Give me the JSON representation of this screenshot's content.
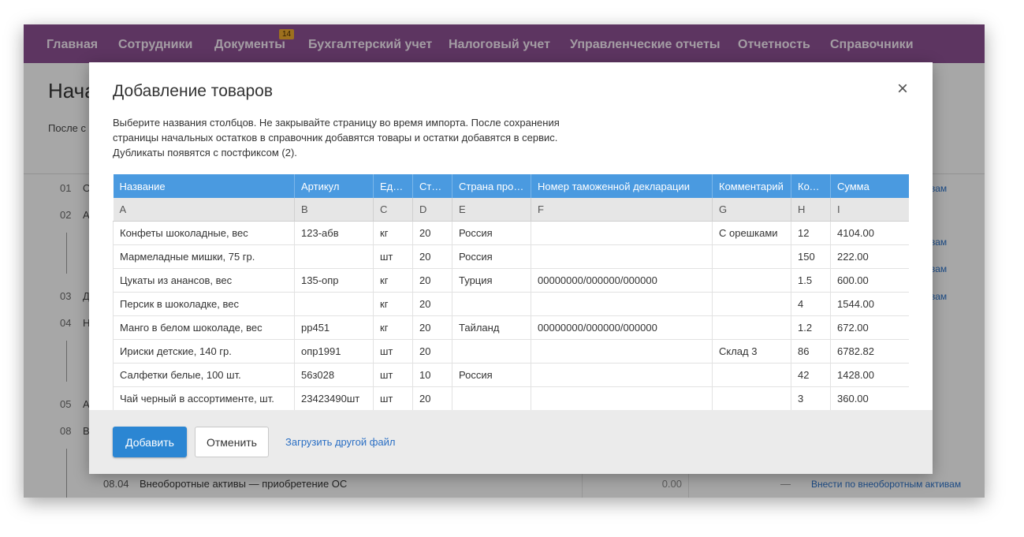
{
  "nav": {
    "items": [
      "Главная",
      "Сотрудники",
      "Документы",
      "Бухгалтерский учет",
      "Налоговый учет",
      "Управленческие отчеты",
      "Отчетность",
      "Справочники"
    ],
    "documents_badge": "14"
  },
  "background": {
    "title": "Нача",
    "subtitle": "После с",
    "steps": [
      {
        "num": "01",
        "letter": "О"
      },
      {
        "num": "02",
        "letter": "А"
      },
      {
        "num": "03",
        "letter": "Д"
      },
      {
        "num": "04",
        "letter": "Н"
      },
      {
        "num": "05",
        "letter": "А"
      },
      {
        "num": "08",
        "letter": "В"
      }
    ],
    "side_links": [
      "вам",
      "вам",
      "вам",
      "вам"
    ],
    "row": {
      "num": "08.04",
      "label": "Внеоборотные активы — приобретение ОС",
      "value": "0.00",
      "dash": "—",
      "link": "Внести по внеоборотным активам"
    }
  },
  "modal": {
    "title": "Добавление товаров",
    "close_symbol": "×",
    "description": [
      "Выберите названия столбцов. Не закрывайте страницу во время импорта. После сохранения",
      "страницы начальных остатков в справочник добавятся товары и остатки добавятся в сервис.",
      "Дубликаты появятся с постфиксом (2)."
    ],
    "table": {
      "headers": [
        "Название",
        "Артикул",
        "Единица измерения",
        "Ставка НДС",
        "Страна производства",
        "Номер таможенной декларации",
        "Комментарий",
        "Количество",
        "Сумма"
      ],
      "letters": [
        "A",
        "B",
        "C",
        "D",
        "E",
        "F",
        "G",
        "H",
        "I"
      ],
      "rows": [
        [
          "Конфеты шоколадные, вес",
          "123-абв",
          "кг",
          "20",
          "Россия",
          "",
          "С орешками",
          "12",
          "4104.00"
        ],
        [
          "Мармеладные мишки, 75 гр.",
          "",
          "шт",
          "20",
          "Россия",
          "",
          "",
          "150",
          "222.00"
        ],
        [
          "Цукаты из анансов, вес",
          "135-опр",
          "кг",
          "20",
          "Турция",
          "00000000/000000/000000",
          "",
          "1.5",
          "600.00"
        ],
        [
          "Персик в шоколадке, вес",
          "",
          "кг",
          "20",
          "",
          "",
          "",
          "4",
          "1544.00"
        ],
        [
          "Манго в белом шоколаде, вес",
          "рр451",
          "кг",
          "20",
          "Тайланд",
          "00000000/000000/000000",
          "",
          "1.2",
          "672.00"
        ],
        [
          "Ириски детские, 140 гр.",
          "опр1991",
          "шт",
          "20",
          "",
          "",
          "Склад 3",
          "86",
          "6782.82"
        ],
        [
          "Салфетки белые, 100 шт.",
          "56з028",
          "шт",
          "10",
          "Россия",
          "",
          "",
          "42",
          "1428.00"
        ],
        [
          "Чай черный в ассортименте, шт.",
          "23423490шт",
          "шт",
          "20",
          "",
          "",
          "",
          "3",
          "360.00"
        ]
      ]
    },
    "footer": {
      "add_label": "Добавить",
      "cancel_label": "Отменить",
      "upload_label": "Загрузить другой файл"
    }
  }
}
